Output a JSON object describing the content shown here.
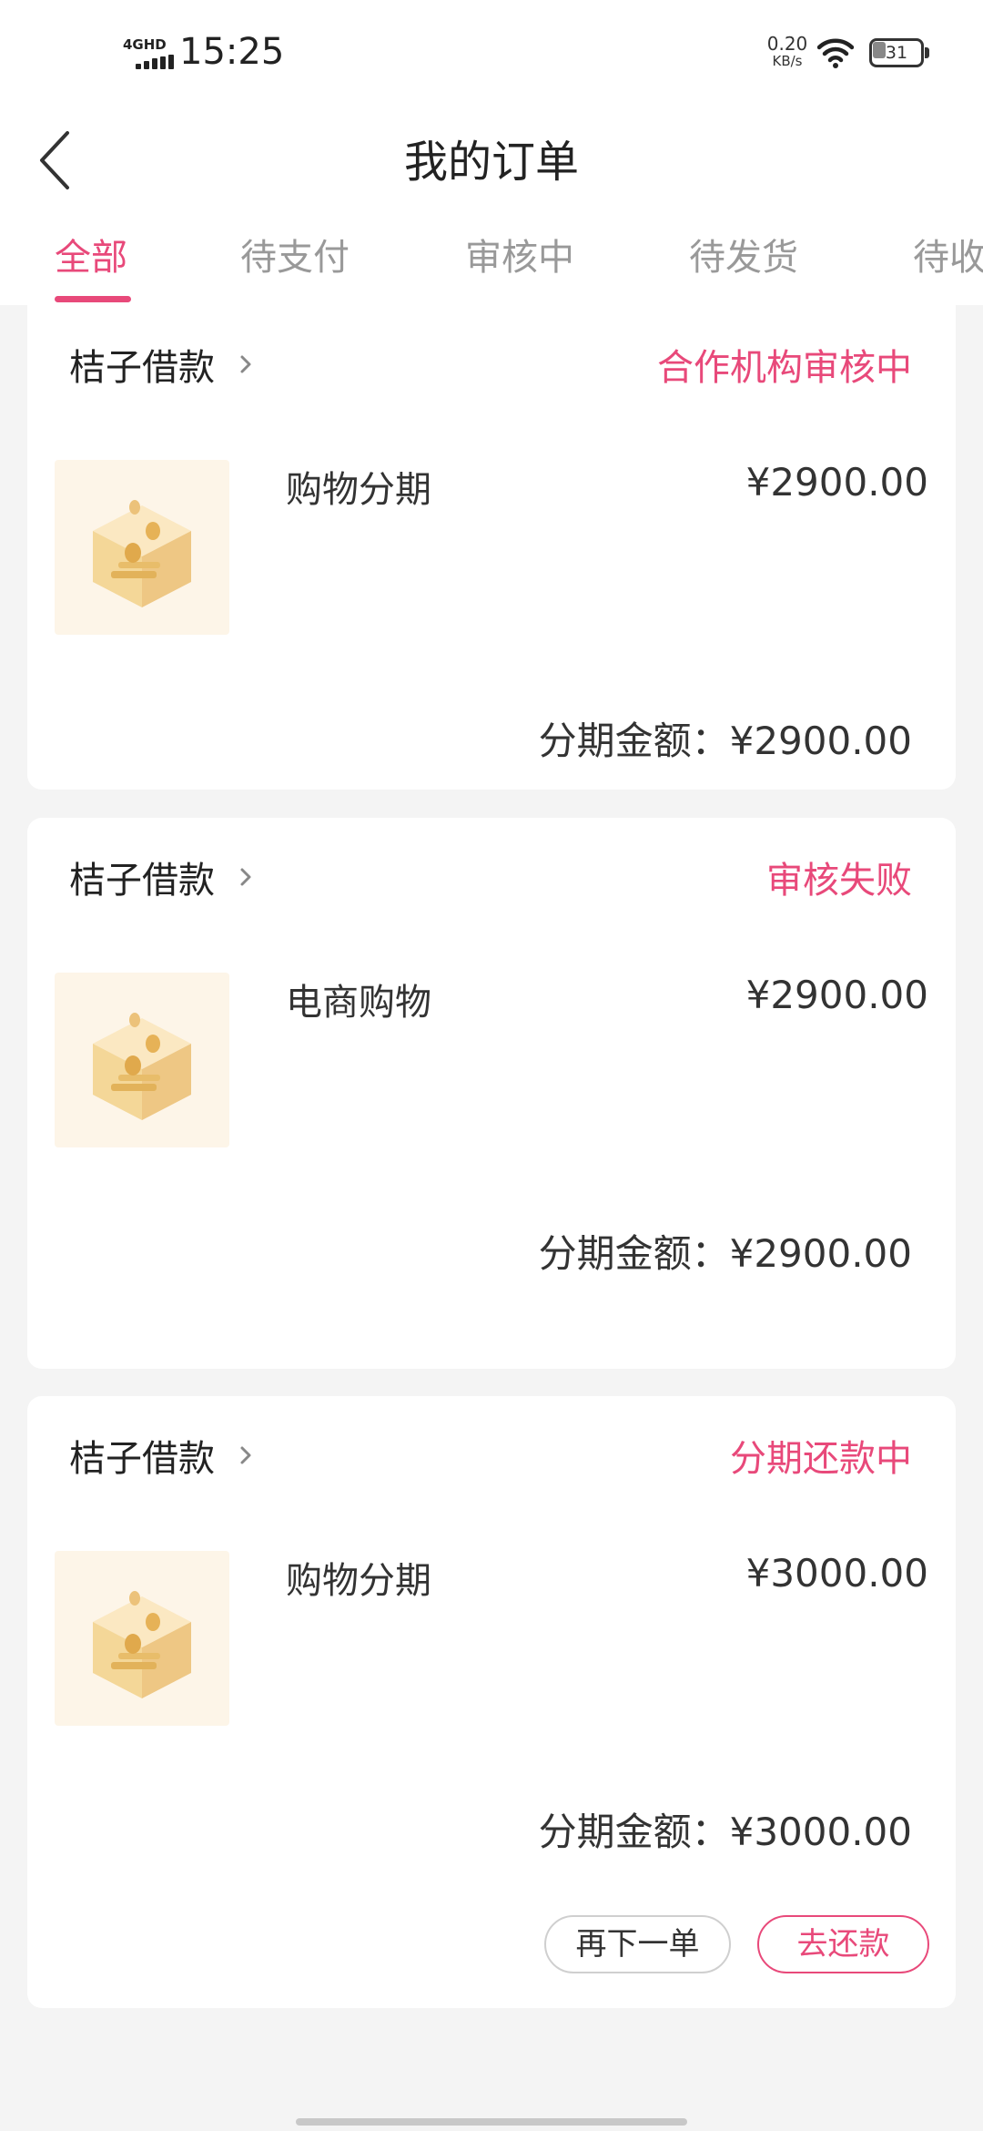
{
  "status_bar": {
    "network": "4GHD",
    "time": "15:25",
    "speed_value": "0.20",
    "speed_unit": "KB/s",
    "battery": "31"
  },
  "header": {
    "title": "我的订单",
    "tabs": [
      {
        "label": "全部",
        "active": true
      },
      {
        "label": "待支付",
        "active": false
      },
      {
        "label": "审核中",
        "active": false
      },
      {
        "label": "待发货",
        "active": false
      },
      {
        "label": "待收",
        "active": false
      }
    ]
  },
  "orders": [
    {
      "merchant": "桔子借款",
      "status": "合作机构审核中",
      "product": "购物分期",
      "price": "¥2900.00",
      "installment_label": "分期金额：",
      "installment_amount": "¥2900.00"
    },
    {
      "merchant": "桔子借款",
      "status": "审核失败",
      "product": "电商购物",
      "price": "¥2900.00",
      "installment_label": "分期金额：",
      "installment_amount": "¥2900.00"
    },
    {
      "merchant": "桔子借款",
      "status": "分期还款中",
      "product": "购物分期",
      "price": "¥3000.00",
      "installment_label": "分期金额：",
      "installment_amount": "¥3000.00",
      "buttons": {
        "reorder": "再下一单",
        "repay": "去还款"
      }
    }
  ],
  "colors": {
    "accent": "#e8497a",
    "background": "#f4f4f4",
    "card": "#ffffff",
    "tab_inactive": "#999999"
  }
}
